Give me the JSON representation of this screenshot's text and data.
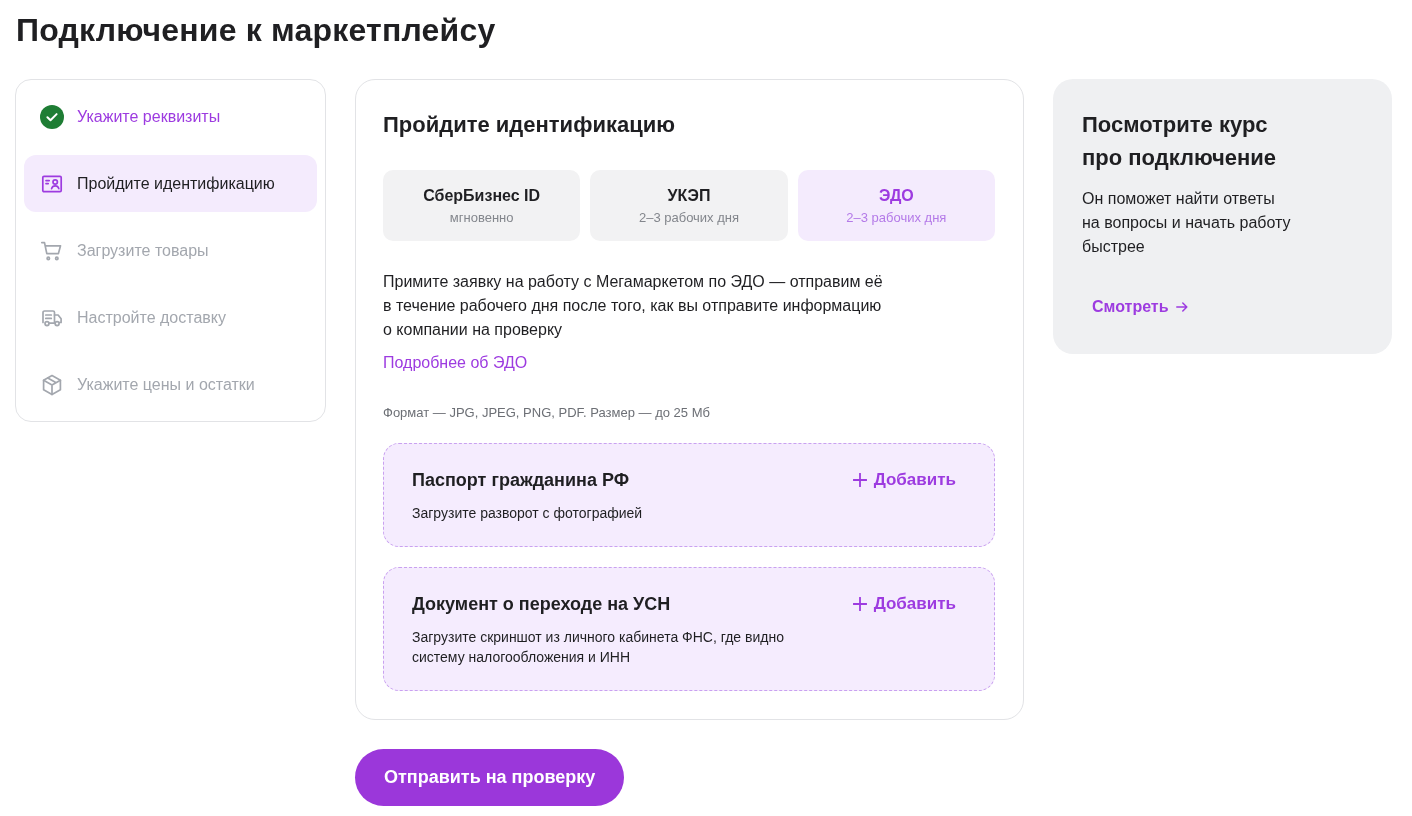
{
  "page_title": "Подключение к маркетплейсу",
  "steps": [
    {
      "label": "Укажите реквизиты",
      "selected": false,
      "completed": true,
      "disabled": false
    },
    {
      "label": "Пройдите идентификацию",
      "selected": true,
      "completed": false,
      "disabled": false
    },
    {
      "label": "Загрузите товары",
      "selected": false,
      "completed": false,
      "disabled": true
    },
    {
      "label": "Настройте доставку",
      "selected": false,
      "completed": false,
      "disabled": true
    },
    {
      "label": "Укажите цены и остатки",
      "selected": false,
      "completed": false,
      "disabled": true
    }
  ],
  "identification": {
    "title": "Пройдите идентификацию",
    "methods": [
      {
        "title": "СберБизнес ID",
        "subtitle": "мгновенно",
        "selected": false
      },
      {
        "title": "УКЭП",
        "subtitle": "2–3 рабочих дня",
        "selected": false
      },
      {
        "title": "ЭДО",
        "subtitle": "2–3 рабочих дня",
        "selected": true
      }
    ],
    "description": "Примите заявку на работу с Мегамаркетом по ЭДО — отправим её в течение рабочего дня после того, как вы отправите информацию о компании на проверку",
    "link": "Подробнее об ЭДО",
    "format_note": "Формат — JPG, JPEG, PNG, PDF. Размер — до 25 Мб",
    "uploads": [
      {
        "title": "Паспорт гражданина РФ",
        "hint": "Загрузите разворот с фотографией",
        "add_label": "Добавить"
      },
      {
        "title": "Документ о переходе на УСН",
        "hint": "Загрузите скриншот из личного кабинета ФНС, где видно систему налогообложения и ИНН",
        "add_label": "Добавить"
      }
    ]
  },
  "submit_button": "Отправить на проверку",
  "course_card": {
    "title": "Посмотрите курс про подключение",
    "text": "Он поможет найти ответы на вопросы и начать работу быстрее",
    "link": "Смотреть"
  }
}
